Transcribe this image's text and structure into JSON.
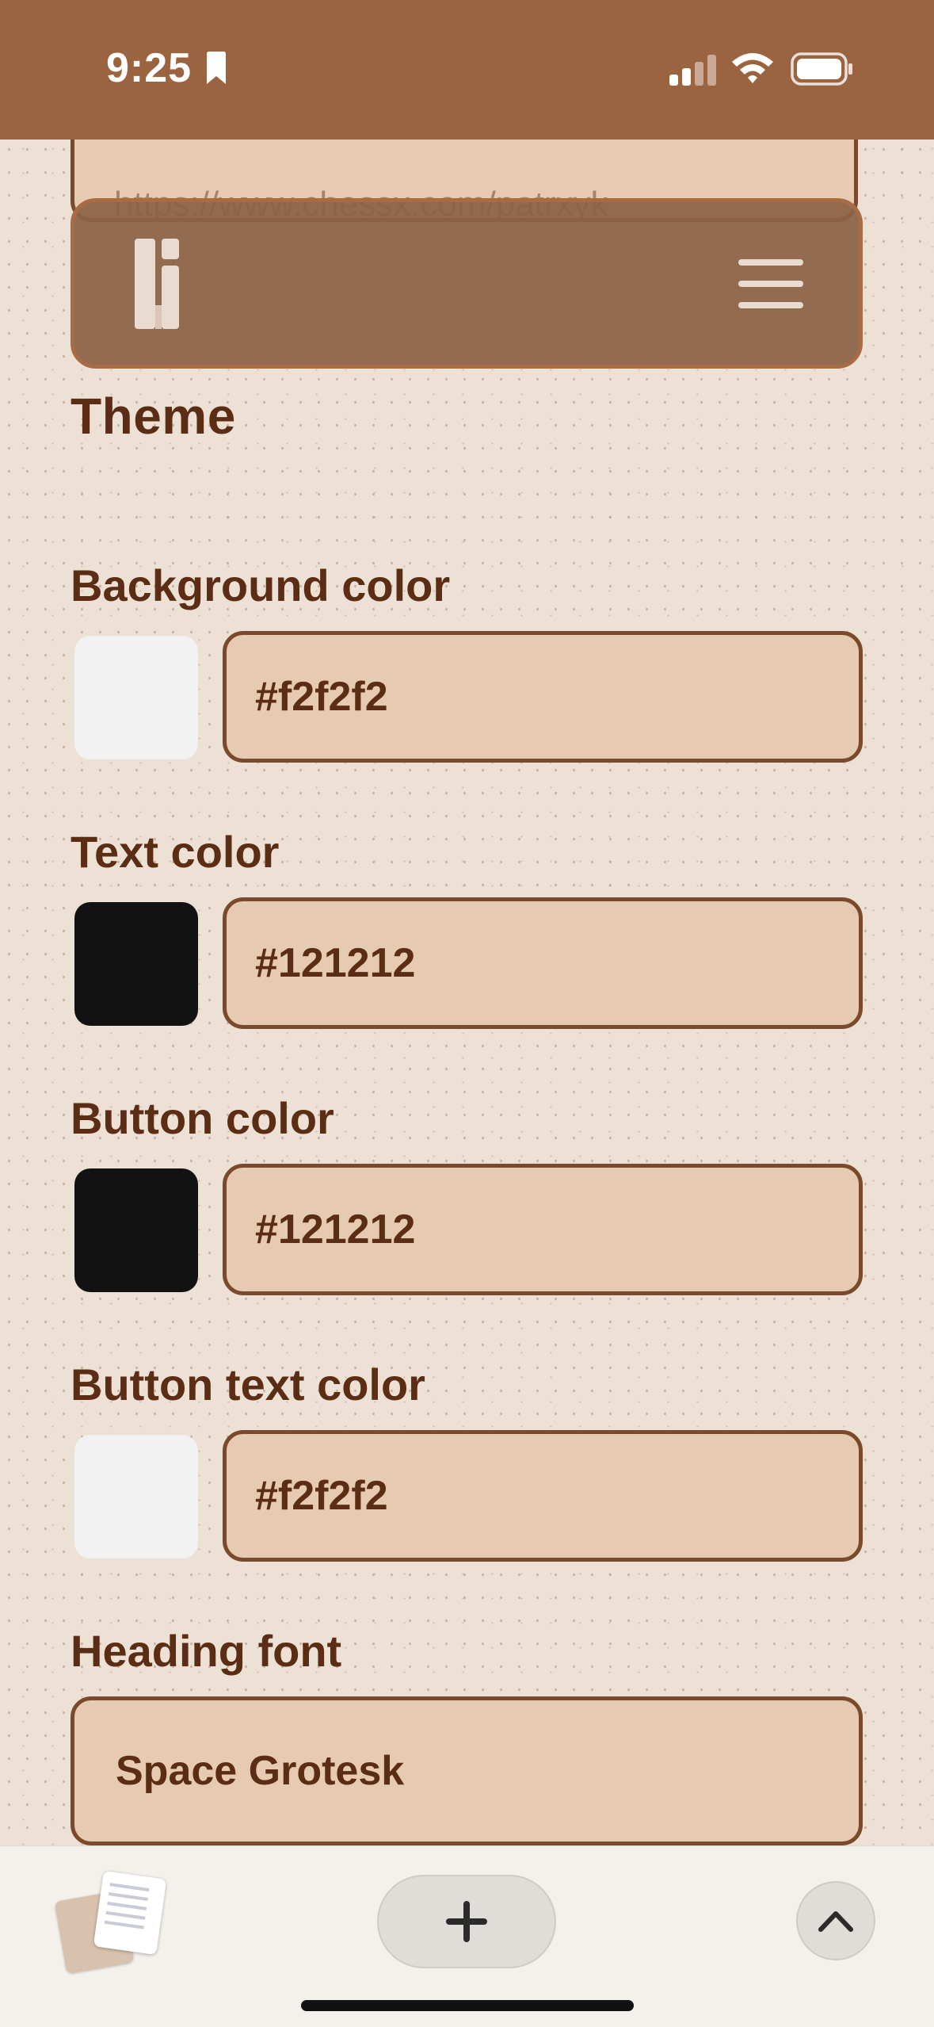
{
  "status_bar": {
    "time": "9:25",
    "icons": [
      "bookmark-icon",
      "cellular-signal-icon",
      "wifi-icon",
      "battery-icon"
    ]
  },
  "url_field": {
    "value": "https://www.chessx.com/patrxyk"
  },
  "nav": {
    "logo": "li-logo-icon",
    "menu": "hamburger-menu-icon"
  },
  "theme": {
    "title": "Theme",
    "background_color": {
      "label": "Background color",
      "value": "#f2f2f2",
      "swatch": "#f2f2f2"
    },
    "text_color": {
      "label": "Text color",
      "value": "#121212",
      "swatch": "#121212"
    },
    "button_color": {
      "label": "Button color",
      "value": "#121212",
      "swatch": "#121212"
    },
    "button_text_color": {
      "label": "Button text color",
      "value": "#f2f2f2",
      "swatch": "#f2f2f2"
    },
    "heading_font": {
      "label": "Heading font",
      "value": "Space Grotesk"
    }
  },
  "toolbar": {
    "tabs": "tab-overview-thumbnail",
    "new_tab": "plus-icon",
    "scroll_up": "chevron-up-icon"
  },
  "colors": {
    "status_bar": "#9b6440",
    "page_background": "#ede0d4",
    "input_background": "#e6cbb2",
    "input_border": "#7b4a2c",
    "text": "#5a2d14",
    "nav_background": "#8c6246"
  }
}
